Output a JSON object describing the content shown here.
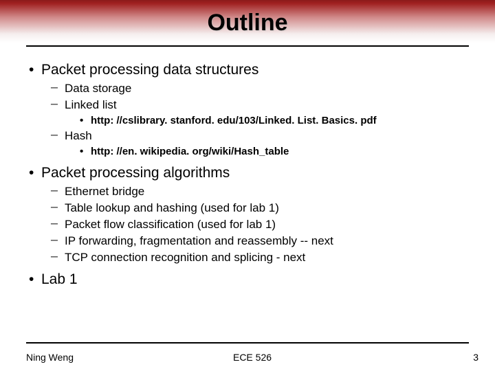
{
  "title": "Outline",
  "bullets": {
    "b1": "Packet processing data structures",
    "b1_1": "Data storage",
    "b1_2": "Linked list",
    "b1_2_1": "http: //cslibrary. stanford. edu/103/Linked. List. Basics. pdf",
    "b1_3": "Hash",
    "b1_3_1": "http: //en. wikipedia. org/wiki/Hash_table",
    "b2": "Packet processing algorithms",
    "b2_1": "Ethernet bridge",
    "b2_2": "Table lookup and hashing (used for lab 1)",
    "b2_3": "Packet flow classification (used for lab 1)",
    "b2_4": "IP forwarding, fragmentation and reassembly  -- next",
    "b2_5": "TCP connection recognition and splicing  - next",
    "b3": "Lab 1"
  },
  "footer": {
    "left": "Ning Weng",
    "center": "ECE 526",
    "right": "3"
  }
}
